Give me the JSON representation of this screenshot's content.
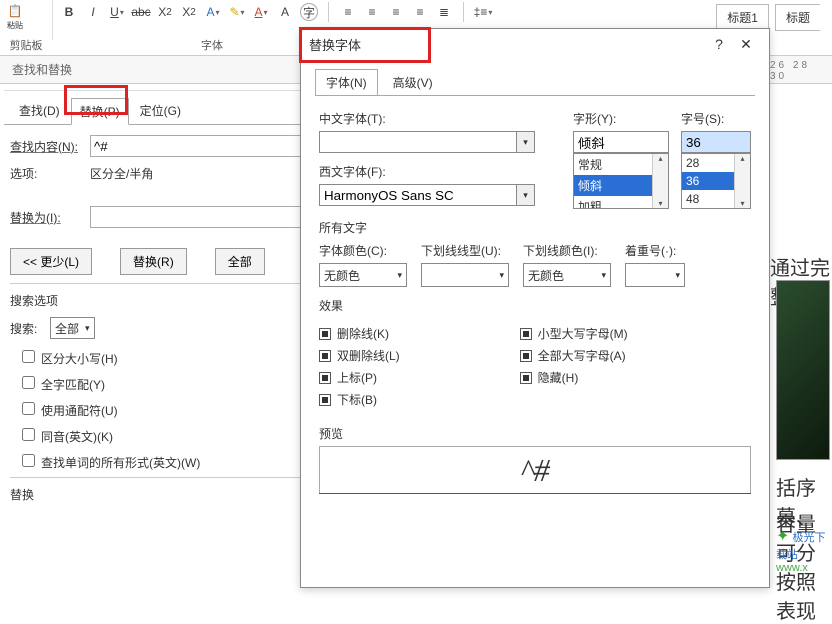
{
  "ribbon": {
    "paste": "粘贴",
    "clipboard_label": "剪贴板",
    "font_label": "字体",
    "style1": "标题1",
    "style2": "标题"
  },
  "search_bar": {
    "label": "查找和替换"
  },
  "fr": {
    "tabs": {
      "find": "查找(D)",
      "replace": "替换(P)",
      "goto": "定位(G)"
    },
    "find_label": "查找内容(N):",
    "find_value": "^#",
    "options_label": "选项:",
    "options_value": "区分全/半角",
    "replace_label": "替换为(I):",
    "replace_value": "",
    "btn_less": "<< 更少(L)",
    "btn_replace": "替换(R)",
    "btn_replace_all": "全部",
    "search_opts_header": "搜索选项",
    "search_label": "搜索:",
    "search_scope": "全部",
    "cb_case": "区分大小写(H)",
    "cb_whole": "全字匹配(Y)",
    "cb_wild": "使用通配符(U)",
    "cb_sounds": "同音(英文)(K)",
    "cb_forms": "查找单词的所有形式(英文)(W)",
    "replace_section": "替换"
  },
  "dlg": {
    "title": "替换字体",
    "tabs": {
      "font": "字体(N)",
      "adv": "高级(V)"
    },
    "cn_font_label": "中文字体(T):",
    "cn_font_value": "",
    "en_font_label": "西文字体(F):",
    "en_font_value": "HarmonyOS Sans SC",
    "style_label": "字形(Y):",
    "style_value": "倾斜",
    "style_opts": [
      "常规",
      "倾斜",
      "加粗"
    ],
    "size_label": "字号(S):",
    "size_value": "36",
    "size_opts": [
      "28",
      "36",
      "48"
    ],
    "all_text": "所有文字",
    "color_label": "字体颜色(C):",
    "color_value": "无颜色",
    "ul_style_label": "下划线线型(U):",
    "ul_style_value": "",
    "ul_color_label": "下划线颜色(I):",
    "ul_color_value": "无颜色",
    "emph_label": "着重号(·):",
    "emph_value": "",
    "effects": "效果",
    "eff_strike": "删除线(K)",
    "eff_dstrike": "双删除线(L)",
    "eff_sup": "上标(P)",
    "eff_sub": "下标(B)",
    "eff_small": "小型大写字母(M)",
    "eff_caps": "全部大写字母(A)",
    "eff_hidden": "隐藏(H)",
    "preview_label": "预览",
    "preview_text": "^#"
  },
  "doc": {
    "ruler": "26   28   30",
    "line1": "通过完整的",
    "line2": "括序幕、",
    "line3": "容量可分",
    "line4": "按照表现",
    "logo1": "极光下载站",
    "logo2": "www.x"
  }
}
